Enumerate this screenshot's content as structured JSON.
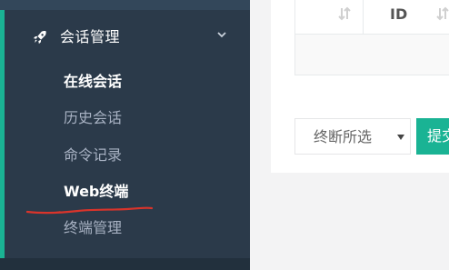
{
  "sidebar": {
    "menu_header": {
      "label": "会话管理",
      "icon": "rocket-icon",
      "expand_icon": "chevron-down-icon"
    },
    "items": [
      {
        "label": "在线会话",
        "active": true
      },
      {
        "label": "历史会话",
        "active": false
      },
      {
        "label": "命令记录",
        "active": false
      },
      {
        "label": "Web终端",
        "active": true
      },
      {
        "label": "终端管理",
        "active": false
      }
    ]
  },
  "table": {
    "columns": [
      {
        "label": "",
        "sortable": true
      },
      {
        "label": "ID",
        "sortable": true
      }
    ]
  },
  "bulk_action": {
    "select_value": "终断所选",
    "submit_label": "提交"
  },
  "colors": {
    "sidebar_bg": "#2b3a4a",
    "accent": "#1ab394",
    "annotation": "#d9342b"
  }
}
